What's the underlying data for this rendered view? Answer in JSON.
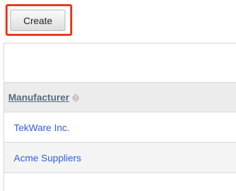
{
  "toolbar": {
    "create_label": "Create"
  },
  "table": {
    "columns": [
      {
        "label": "Manufacturer",
        "sortable": true
      }
    ],
    "rows": [
      {
        "manufacturer": "TekWare Inc."
      },
      {
        "manufacturer": "Acme Suppliers"
      }
    ]
  },
  "colors": {
    "highlight": "#e8391d",
    "header_text": "#556b80",
    "link": "#2e5fd9",
    "header_bg": "#ececec"
  },
  "icons": {
    "sort": "sort-icon"
  }
}
